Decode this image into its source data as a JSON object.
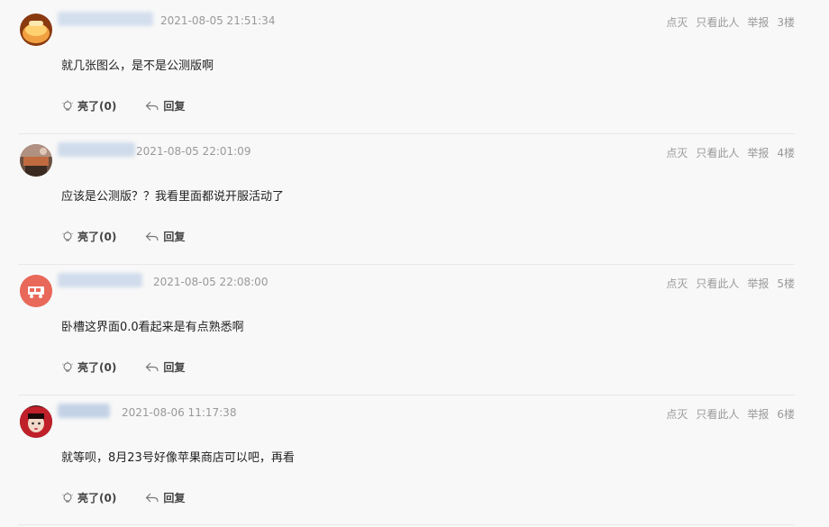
{
  "comments": [
    {
      "time": "2021-08-05 21:51:34",
      "content": "就几张图么，是不是公测版啊",
      "floor": "3楼",
      "like_label": "亮了(0)",
      "reply_label": "回复",
      "avatar_icon": "cake-avatar",
      "avatar_color": "#f0a040"
    },
    {
      "time": "2021-08-05 22:01:09",
      "content": "应该是公测版？？我看里面都说开服活动了",
      "floor": "4楼",
      "like_label": "亮了(0)",
      "reply_label": "回复",
      "avatar_icon": "photo-avatar",
      "avatar_color": "#8a6a55"
    },
    {
      "time": "2021-08-05 22:08:00",
      "content": "卧槽这界面0.0看起来是有点熟悉啊",
      "floor": "5楼",
      "like_label": "亮了(0)",
      "reply_label": "回复",
      "avatar_icon": "vehicle-avatar",
      "avatar_color": "#e8685a"
    },
    {
      "time": "2021-08-06 11:17:38",
      "content": "就等呗，8月23号好像苹果商店可以吧，再看",
      "floor": "6楼",
      "like_label": "亮了(0)",
      "reply_label": "回复",
      "avatar_icon": "girl-avatar",
      "avatar_color": "#c0202a"
    }
  ],
  "actions": {
    "dislike": "点灭",
    "only_this": "只看此人",
    "report": "举报"
  },
  "colors": {
    "name_blur": "#c8d6e8",
    "text_muted": "#999999"
  }
}
